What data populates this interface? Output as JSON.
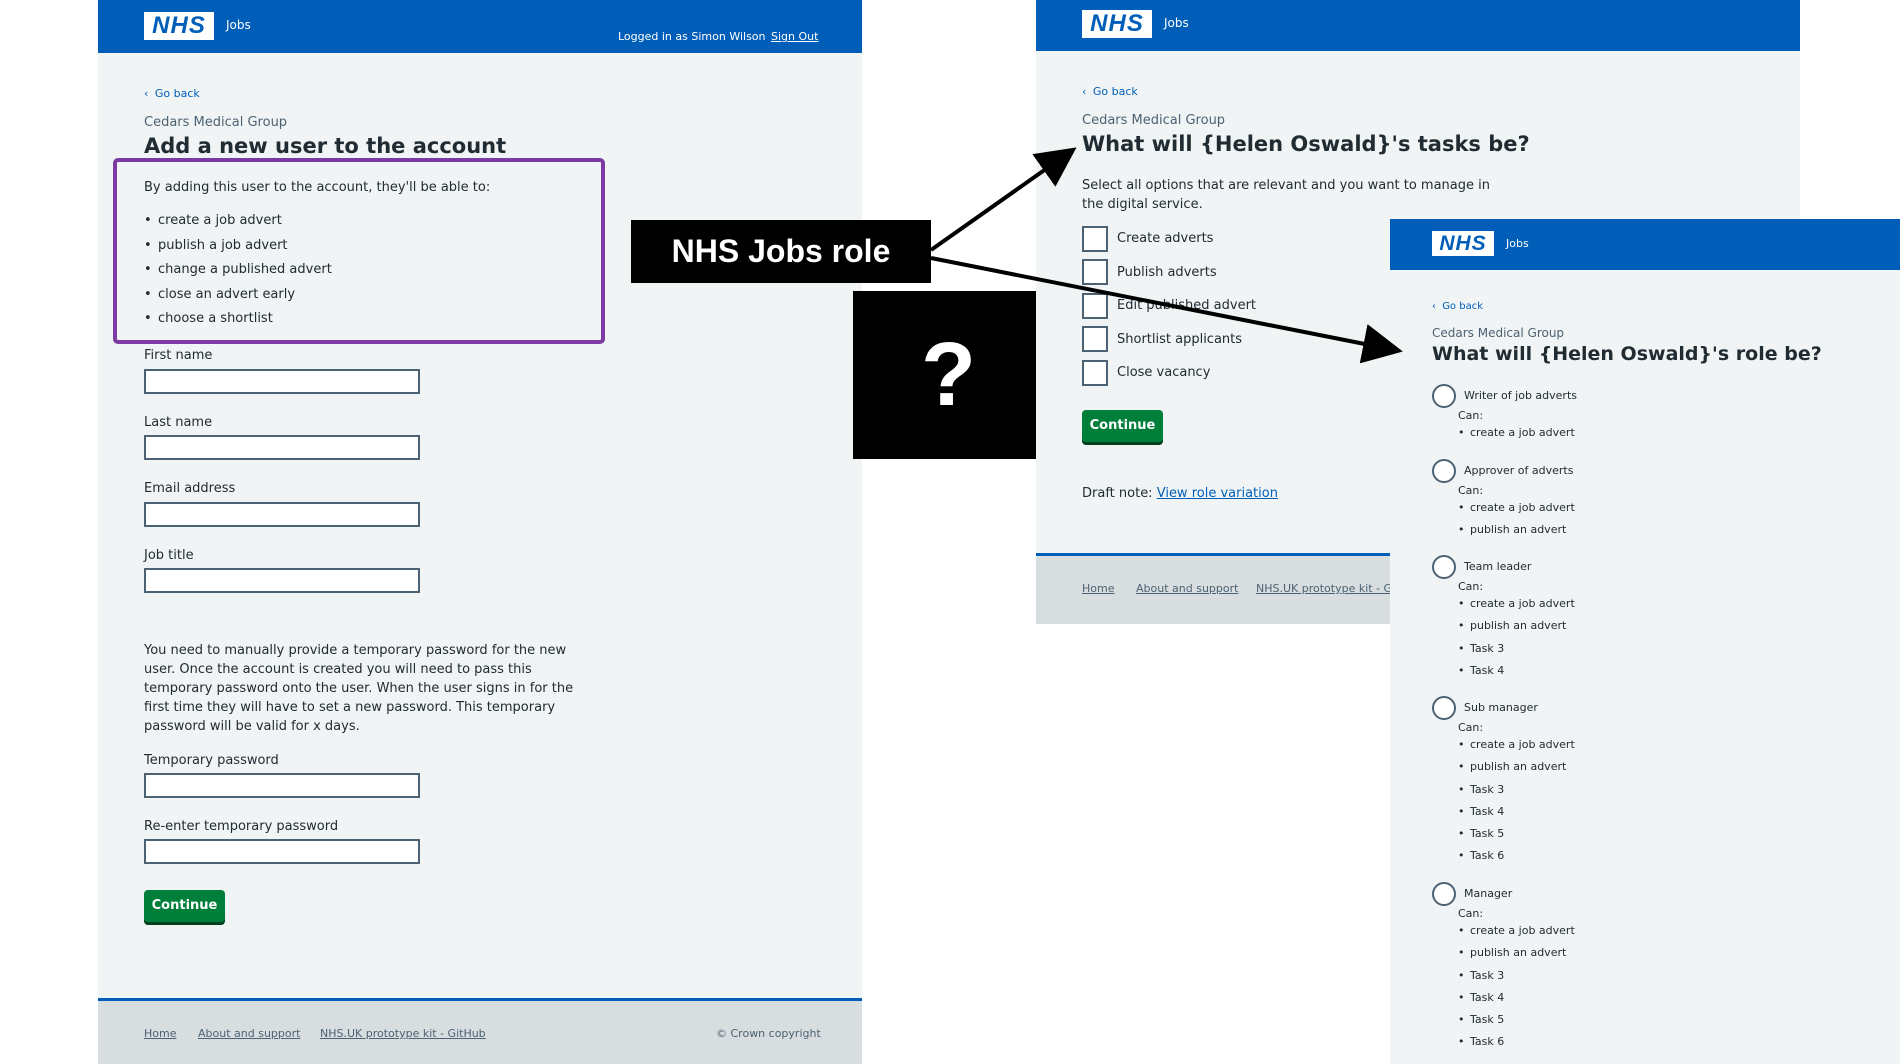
{
  "left": {
    "header": {
      "logo": "NHS",
      "service": "Jobs",
      "logged_in": "Logged in as Simon Wilson",
      "sign_out": "Sign Out"
    },
    "go_back": "Go back",
    "org": "Cedars Medical Group",
    "title": "Add a new user to the account",
    "intro": "By adding this user to the account, they'll be able to:",
    "abilities": [
      "create a job advert",
      "publish a job advert",
      "change a published advert",
      "close an advert early",
      "choose a shortlist"
    ],
    "fields": {
      "first_name": "First name",
      "last_name": "Last name",
      "email": "Email address",
      "job_title": "Job title"
    },
    "password_note": "You need to manually provide a temporary password for the new user. Once the account is created you will need to pass this temporary password onto the user. When the user signs in for the first time they will have to set a new password. This temporary password will be valid for x days.",
    "temp_password": "Temporary password",
    "reenter_password": "Re-enter temporary password",
    "continue": "Continue",
    "footer": {
      "home": "Home",
      "about": "About and support",
      "kit": "NHS.UK prototype kit - GitHub",
      "copyright": "© Crown copyright"
    }
  },
  "callout": {
    "label": "NHS Jobs role",
    "question": "?"
  },
  "middle": {
    "header": {
      "logo": "NHS",
      "service": "Jobs"
    },
    "go_back": "Go back",
    "org": "Cedars Medical Group",
    "title": "What will {Helen Oswald}'s tasks be?",
    "hint": "Select all options that are relevant and you want to manage in the digital service.",
    "options": [
      "Create adverts",
      "Publish adverts",
      "Edit published advert",
      "Shortlist applicants",
      "Close vacancy"
    ],
    "continue": "Continue",
    "draft_note": "Draft note:",
    "draft_link": "View role variation",
    "footer": {
      "home": "Home",
      "about": "About and support",
      "kit": "NHS.UK prototype kit - Gi"
    }
  },
  "right": {
    "header": {
      "logo": "NHS",
      "service": "Jobs"
    },
    "go_back": "Go back",
    "org": "Cedars Medical Group",
    "title": "What will {Helen Oswald}'s role be?",
    "can_label": "Can:",
    "roles": [
      {
        "name": "Writer of job adverts",
        "tasks": [
          "create a job advert"
        ]
      },
      {
        "name": "Approver of adverts",
        "tasks": [
          "create a job advert",
          "publish an advert"
        ]
      },
      {
        "name": "Team leader",
        "tasks": [
          "create a job advert",
          "publish an advert",
          "Task 3",
          "Task 4"
        ]
      },
      {
        "name": "Sub manager",
        "tasks": [
          "create a job advert",
          "publish an advert",
          "Task 3",
          "Task 4",
          "Task 5",
          "Task 6"
        ]
      },
      {
        "name": "Manager",
        "tasks": [
          "create a job advert",
          "publish an advert",
          "Task 3",
          "Task 4",
          "Task 5",
          "Task 6"
        ]
      }
    ]
  },
  "colors": {
    "nhs_blue": "#005eb8",
    "green": "#007f3b",
    "purple": "#7c3aa3",
    "panel_bg": "#f0f4f5"
  }
}
